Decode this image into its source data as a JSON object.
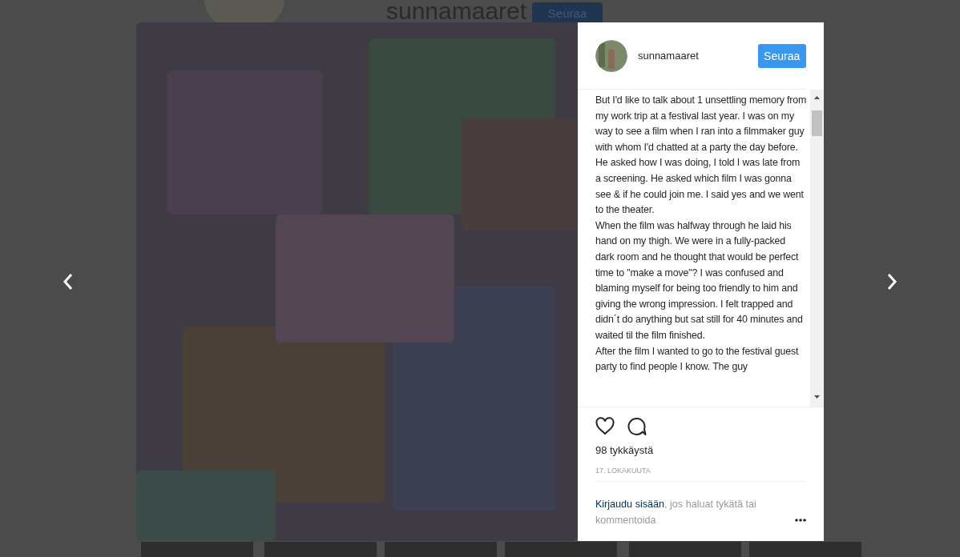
{
  "background_page": {
    "username": "sunnamaaret",
    "follow_button": "Seuraa"
  },
  "post": {
    "header": {
      "username": "sunnamaaret",
      "follow_button": "Seuraa"
    },
    "caption": [
      "But I'd like to talk about 1 unsettling memory from my work trip at a festival last year. I was on my way to see a film when I ran into a filmmaker guy with whom I'd chatted at a party the day before. He asked how I was doing, I told I was late from a screening. He asked which film I was gonna see & if he could join me. I said yes and we went to the theater.",
      "When the film was halfway through he laid his hand on my thigh. We were in a fully-packed dark room and he thought that would be perfect time to \"make a move\"? I was confused and blaming myself for being too friendly to him and giving the wrong impression. I felt trapped and didn´t do anything but sat still for 40 minutes and waited til the film finished.",
      "After the film I wanted to go to the festival guest party to find people I know. The guy"
    ],
    "likes": "98 tykkäystä",
    "date": "17. LOKAKUUTA",
    "login_prompt": {
      "link": "Kirjaudu sisään",
      "text": ", jos haluat tykätä tai kommentoida"
    }
  }
}
